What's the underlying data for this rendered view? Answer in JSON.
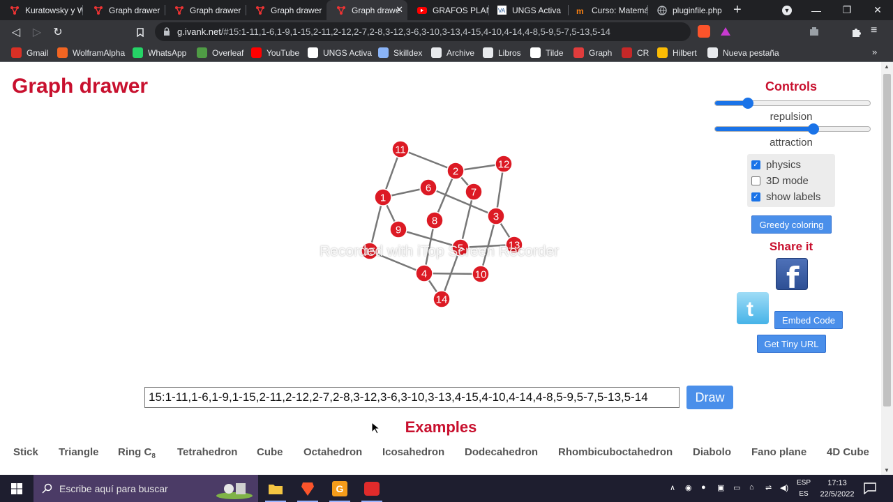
{
  "browser": {
    "tabs": [
      {
        "title": "Kuratowsky y W",
        "icon": "graph-app-icon"
      },
      {
        "title": "Graph drawer",
        "icon": "graph-app-icon"
      },
      {
        "title": "Graph drawer",
        "icon": "graph-app-icon"
      },
      {
        "title": "Graph drawer",
        "icon": "graph-app-icon"
      },
      {
        "title": "Graph drawe",
        "icon": "graph-app-icon",
        "active": true
      },
      {
        "title": "GRAFOS PLANA",
        "icon": "youtube-icon"
      },
      {
        "title": "UNGS Activa",
        "icon": "ungs-icon"
      },
      {
        "title": "Curso: Matemát",
        "icon": "moodle-icon"
      },
      {
        "title": "pluginfile.php",
        "icon": "globe-icon"
      }
    ],
    "url_host": "g.ivank.net",
    "url_path": "/#15:1-11,1-6,1-9,1-15,2-11,2-12,2-7,2-8,3-12,3-6,3-10,3-13,4-15,4-10,4-14,4-8,5-9,5-7,5-13,5-14",
    "bookmarks": [
      {
        "label": "Gmail",
        "color": "#d93025"
      },
      {
        "label": "WolframAlpha",
        "color": "#f26522"
      },
      {
        "label": "WhatsApp",
        "color": "#25d366"
      },
      {
        "label": "Overleaf",
        "color": "#4f9c45"
      },
      {
        "label": "YouTube",
        "color": "#ff0000"
      },
      {
        "label": "UNGS Activa",
        "color": "#ffffff"
      },
      {
        "label": "Skilldex",
        "color": "#8ab4f8"
      },
      {
        "label": "Archive",
        "color": "#e8eaed"
      },
      {
        "label": "Libros",
        "color": "#e8eaed"
      },
      {
        "label": "Tilde",
        "color": "#ffffff"
      },
      {
        "label": "Graph",
        "color": "#e03c3c"
      },
      {
        "label": "CR",
        "color": "#c62828"
      },
      {
        "label": "Hilbert",
        "color": "#fbbc04"
      },
      {
        "label": "Nueva pestaña",
        "color": "#e8eaed"
      }
    ]
  },
  "page": {
    "title": "Graph drawer",
    "controls_title": "Controls",
    "sliders": [
      {
        "label": "repulsion",
        "value": 0.21
      },
      {
        "label": "attraction",
        "value": 0.63
      }
    ],
    "options": [
      {
        "label": "physics",
        "checked": true
      },
      {
        "label": "3D mode",
        "checked": false
      },
      {
        "label": "show labels",
        "checked": true
      }
    ],
    "greedy_button": "Greedy coloring",
    "share_title": "Share it",
    "embed_button": "Embed Code",
    "tiny_url_button": "Get Tiny URL",
    "edges_input": "15:1-11,1-6,1-9,1-15,2-11,2-12,2-7,2-8,3-12,3-6,3-10,3-13,4-15,4-10,4-14,4-8,5-9,5-7,5-13,5-14",
    "draw_button": "Draw",
    "examples_title": "Examples",
    "examples": [
      "Stick",
      "Triangle",
      "Ring C",
      "Tetrahedron",
      "Cube",
      "Octahedron",
      "Icosahedron",
      "Dodecahedron",
      "Rhombicuboctahedron",
      "Diabolo",
      "Fano plane",
      "4D Cube"
    ],
    "ring_subscript": "8",
    "watermark": "Recorded with iTop Screen Recorder",
    "node_color": "#dc1a24",
    "accent": "#1a73e8",
    "heading_color": "#c8102e"
  },
  "graph": {
    "node_labels": [
      "1",
      "2",
      "3",
      "4",
      "5",
      "6",
      "7",
      "8",
      "9",
      "10",
      "11",
      "12",
      "13",
      "14",
      "15"
    ],
    "edges": [
      [
        1,
        11
      ],
      [
        1,
        6
      ],
      [
        1,
        9
      ],
      [
        1,
        15
      ],
      [
        2,
        11
      ],
      [
        2,
        12
      ],
      [
        2,
        7
      ],
      [
        2,
        8
      ],
      [
        3,
        12
      ],
      [
        3,
        6
      ],
      [
        3,
        10
      ],
      [
        3,
        13
      ],
      [
        4,
        15
      ],
      [
        4,
        10
      ],
      [
        4,
        14
      ],
      [
        4,
        8
      ],
      [
        5,
        9
      ],
      [
        5,
        7
      ],
      [
        5,
        13
      ],
      [
        5,
        14
      ]
    ]
  },
  "taskbar": {
    "search_placeholder": "Escribe aquí para buscar",
    "lang_top": "ESP",
    "lang_bottom": "ES",
    "time": "17:13",
    "date": "22/5/2022"
  }
}
